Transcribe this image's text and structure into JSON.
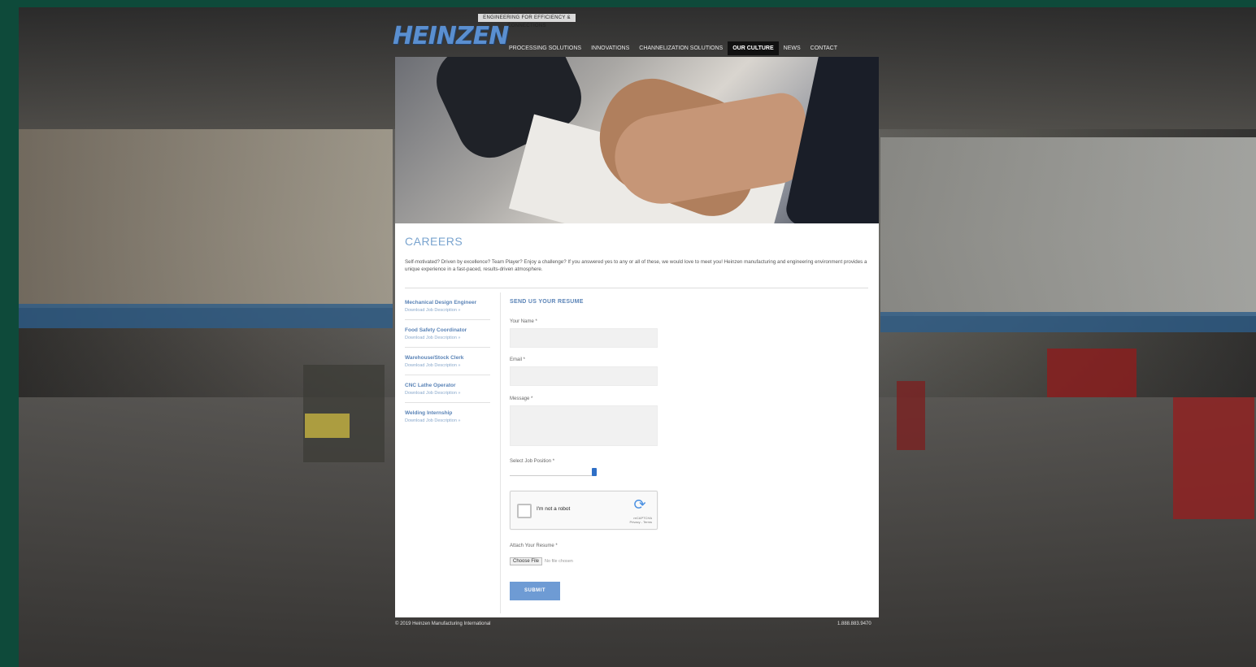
{
  "brand": {
    "tagline": "ENGINEERING FOR EFFICIENCY & CONNECTIONS",
    "logo_text": "HEINZEN"
  },
  "nav": {
    "items": [
      {
        "label": "PROCESSING SOLUTIONS"
      },
      {
        "label": "INNOVATIONS"
      },
      {
        "label": "CHANNELIZATION SOLUTIONS"
      },
      {
        "label": "OUR CULTURE",
        "active": true
      },
      {
        "label": "NEWS"
      },
      {
        "label": "CONTACT"
      }
    ]
  },
  "page": {
    "title": "CAREERS",
    "intro": "Self-motivated? Driven by excellence? Team Player? Enjoy a challenge? If you answered yes to any or all of these, we would love to meet you! Heinzen manufacturing and engineering environment provides a unique experience in a fast-paced, results-driven atmosphere."
  },
  "jobs": [
    {
      "name": "Mechanical Design Engineer",
      "link": "Download Job Description »"
    },
    {
      "name": "Food Safety Coordinator",
      "link": "Download Job Description »"
    },
    {
      "name": "Warehouse/Stock Clerk",
      "link": "Download Job Description »"
    },
    {
      "name": "CNC Lathe Operator",
      "link": "Download Job Description »"
    },
    {
      "name": "Welding Internship",
      "link": "Download Job Description »"
    }
  ],
  "form": {
    "heading": "SEND US YOUR RESUME",
    "name_label": "Your Name *",
    "email_label": "Email *",
    "message_label": "Message *",
    "position_label": "Select Job Position *",
    "captcha_text": "I'm not a robot",
    "captcha_brand": "reCAPTCHA",
    "captcha_privacy": "Privacy - Terms",
    "resume_label": "Attach Your Resume *",
    "file_button": "Choose File",
    "file_status": "No file chosen",
    "submit_label": "SUBMIT"
  },
  "footer": {
    "copyright": "© 2019 Heinzen Manufacturing International",
    "phone": "1.888.883.9470"
  }
}
